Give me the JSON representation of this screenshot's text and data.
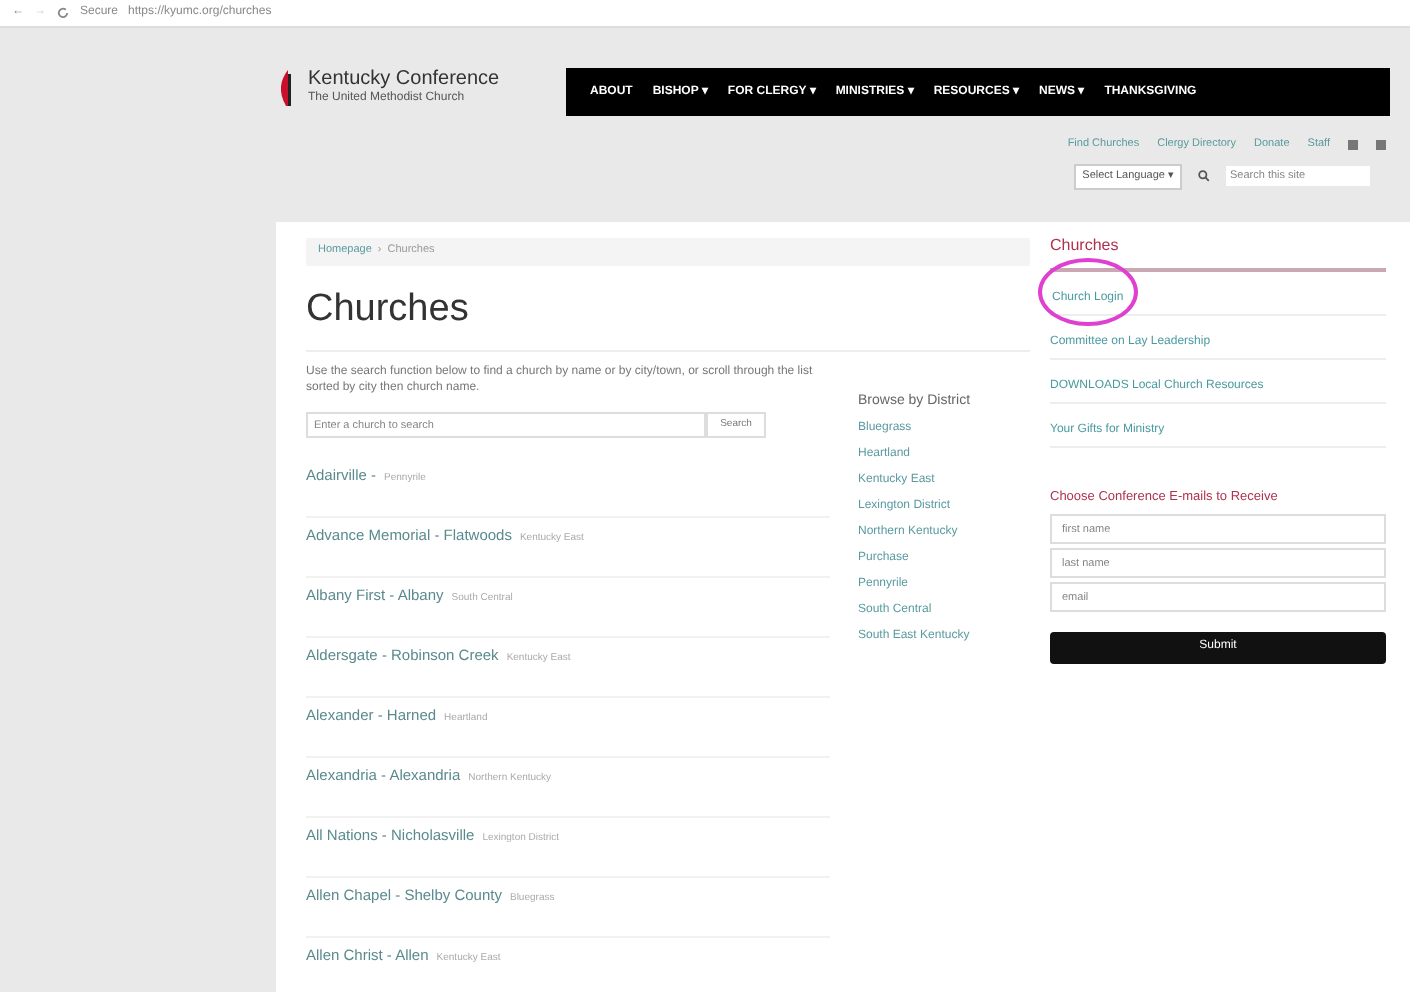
{
  "browser": {
    "nav_back": "←",
    "nav_forward": "→",
    "secure": "Secure",
    "url": "https://kyumc.org/churches"
  },
  "header": {
    "logo_title": "Kentucky Conference",
    "logo_subtitle": "The United Methodist Church",
    "nav": [
      "ABOUT",
      "BISHOP ▾",
      "FOR CLERGY ▾",
      "MINISTRIES ▾",
      "RESOURCES ▾",
      "NEWS ▾",
      "THANKSGIVING"
    ],
    "utility_links": [
      "Find Churches",
      "Clergy Directory",
      "Donate",
      "Staff"
    ],
    "language": "Select Language ▾",
    "search_placeholder": "Search this site"
  },
  "breadcrumb": [
    "Homepage",
    "›",
    "Churches"
  ],
  "title": "Churches",
  "intro": "Use the search function below to find a church by name or by city/town, or scroll through the list sorted by city then church name.",
  "search": {
    "placeholder": "Enter a church to search",
    "button": "Search"
  },
  "churches": [
    {
      "name": "Adairville -",
      "district": "Pennyrile"
    },
    {
      "name": "Advance Memorial - Flatwoods",
      "district": "Kentucky East"
    },
    {
      "name": "Albany First - Albany",
      "district": "South Central"
    },
    {
      "name": "Aldersgate - Robinson Creek",
      "district": "Kentucky East"
    },
    {
      "name": "Alexander - Harned",
      "district": "Heartland"
    },
    {
      "name": "Alexandria - Alexandria",
      "district": "Northern Kentucky"
    },
    {
      "name": "All Nations - Nicholasville",
      "district": "Lexington District"
    },
    {
      "name": "Allen Chapel - Shelby County",
      "district": "Bluegrass"
    },
    {
      "name": "Allen Christ - Allen",
      "district": "Kentucky East"
    }
  ],
  "districts": {
    "heading": "Browse by District",
    "items": [
      "Bluegrass",
      "Heartland",
      "Kentucky East",
      "Lexington District",
      "Northern Kentucky",
      "Purchase",
      "Pennyrile",
      "South Central",
      "South East Kentucky"
    ]
  },
  "sidebar": {
    "heading": "Churches",
    "links": [
      {
        "label": "Church Login",
        "circled": true
      },
      {
        "label": "Committee on Lay Leadership",
        "circled": false
      },
      {
        "label": "DOWNLOADS Local Church Resources",
        "circled": false
      },
      {
        "label": "Your Gifts for Ministry",
        "circled": false
      }
    ],
    "form_heading": "Choose Conference E-mails to Receive",
    "fields": [
      {
        "placeholder": "first name"
      },
      {
        "placeholder": "last name"
      },
      {
        "placeholder": "email"
      }
    ],
    "submit": "Submit"
  }
}
